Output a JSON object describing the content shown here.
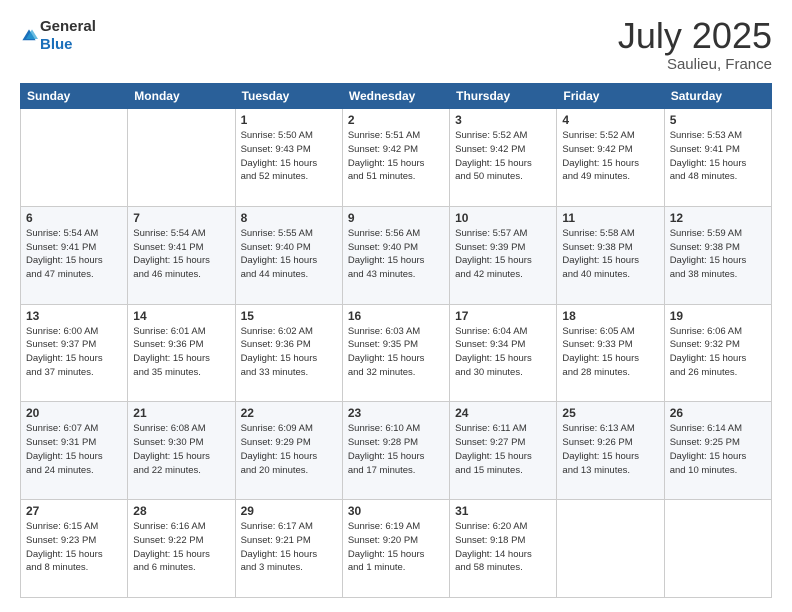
{
  "header": {
    "logo_general": "General",
    "logo_blue": "Blue",
    "title": "July 2025",
    "location": "Saulieu, France"
  },
  "calendar": {
    "days": [
      "Sunday",
      "Monday",
      "Tuesday",
      "Wednesday",
      "Thursday",
      "Friday",
      "Saturday"
    ],
    "rows": [
      [
        {
          "day": "",
          "info": ""
        },
        {
          "day": "",
          "info": ""
        },
        {
          "day": "1",
          "info": "Sunrise: 5:50 AM\nSunset: 9:43 PM\nDaylight: 15 hours\nand 52 minutes."
        },
        {
          "day": "2",
          "info": "Sunrise: 5:51 AM\nSunset: 9:42 PM\nDaylight: 15 hours\nand 51 minutes."
        },
        {
          "day": "3",
          "info": "Sunrise: 5:52 AM\nSunset: 9:42 PM\nDaylight: 15 hours\nand 50 minutes."
        },
        {
          "day": "4",
          "info": "Sunrise: 5:52 AM\nSunset: 9:42 PM\nDaylight: 15 hours\nand 49 minutes."
        },
        {
          "day": "5",
          "info": "Sunrise: 5:53 AM\nSunset: 9:41 PM\nDaylight: 15 hours\nand 48 minutes."
        }
      ],
      [
        {
          "day": "6",
          "info": "Sunrise: 5:54 AM\nSunset: 9:41 PM\nDaylight: 15 hours\nand 47 minutes."
        },
        {
          "day": "7",
          "info": "Sunrise: 5:54 AM\nSunset: 9:41 PM\nDaylight: 15 hours\nand 46 minutes."
        },
        {
          "day": "8",
          "info": "Sunrise: 5:55 AM\nSunset: 9:40 PM\nDaylight: 15 hours\nand 44 minutes."
        },
        {
          "day": "9",
          "info": "Sunrise: 5:56 AM\nSunset: 9:40 PM\nDaylight: 15 hours\nand 43 minutes."
        },
        {
          "day": "10",
          "info": "Sunrise: 5:57 AM\nSunset: 9:39 PM\nDaylight: 15 hours\nand 42 minutes."
        },
        {
          "day": "11",
          "info": "Sunrise: 5:58 AM\nSunset: 9:38 PM\nDaylight: 15 hours\nand 40 minutes."
        },
        {
          "day": "12",
          "info": "Sunrise: 5:59 AM\nSunset: 9:38 PM\nDaylight: 15 hours\nand 38 minutes."
        }
      ],
      [
        {
          "day": "13",
          "info": "Sunrise: 6:00 AM\nSunset: 9:37 PM\nDaylight: 15 hours\nand 37 minutes."
        },
        {
          "day": "14",
          "info": "Sunrise: 6:01 AM\nSunset: 9:36 PM\nDaylight: 15 hours\nand 35 minutes."
        },
        {
          "day": "15",
          "info": "Sunrise: 6:02 AM\nSunset: 9:36 PM\nDaylight: 15 hours\nand 33 minutes."
        },
        {
          "day": "16",
          "info": "Sunrise: 6:03 AM\nSunset: 9:35 PM\nDaylight: 15 hours\nand 32 minutes."
        },
        {
          "day": "17",
          "info": "Sunrise: 6:04 AM\nSunset: 9:34 PM\nDaylight: 15 hours\nand 30 minutes."
        },
        {
          "day": "18",
          "info": "Sunrise: 6:05 AM\nSunset: 9:33 PM\nDaylight: 15 hours\nand 28 minutes."
        },
        {
          "day": "19",
          "info": "Sunrise: 6:06 AM\nSunset: 9:32 PM\nDaylight: 15 hours\nand 26 minutes."
        }
      ],
      [
        {
          "day": "20",
          "info": "Sunrise: 6:07 AM\nSunset: 9:31 PM\nDaylight: 15 hours\nand 24 minutes."
        },
        {
          "day": "21",
          "info": "Sunrise: 6:08 AM\nSunset: 9:30 PM\nDaylight: 15 hours\nand 22 minutes."
        },
        {
          "day": "22",
          "info": "Sunrise: 6:09 AM\nSunset: 9:29 PM\nDaylight: 15 hours\nand 20 minutes."
        },
        {
          "day": "23",
          "info": "Sunrise: 6:10 AM\nSunset: 9:28 PM\nDaylight: 15 hours\nand 17 minutes."
        },
        {
          "day": "24",
          "info": "Sunrise: 6:11 AM\nSunset: 9:27 PM\nDaylight: 15 hours\nand 15 minutes."
        },
        {
          "day": "25",
          "info": "Sunrise: 6:13 AM\nSunset: 9:26 PM\nDaylight: 15 hours\nand 13 minutes."
        },
        {
          "day": "26",
          "info": "Sunrise: 6:14 AM\nSunset: 9:25 PM\nDaylight: 15 hours\nand 10 minutes."
        }
      ],
      [
        {
          "day": "27",
          "info": "Sunrise: 6:15 AM\nSunset: 9:23 PM\nDaylight: 15 hours\nand 8 minutes."
        },
        {
          "day": "28",
          "info": "Sunrise: 6:16 AM\nSunset: 9:22 PM\nDaylight: 15 hours\nand 6 minutes."
        },
        {
          "day": "29",
          "info": "Sunrise: 6:17 AM\nSunset: 9:21 PM\nDaylight: 15 hours\nand 3 minutes."
        },
        {
          "day": "30",
          "info": "Sunrise: 6:19 AM\nSunset: 9:20 PM\nDaylight: 15 hours\nand 1 minute."
        },
        {
          "day": "31",
          "info": "Sunrise: 6:20 AM\nSunset: 9:18 PM\nDaylight: 14 hours\nand 58 minutes."
        },
        {
          "day": "",
          "info": ""
        },
        {
          "day": "",
          "info": ""
        }
      ]
    ]
  }
}
